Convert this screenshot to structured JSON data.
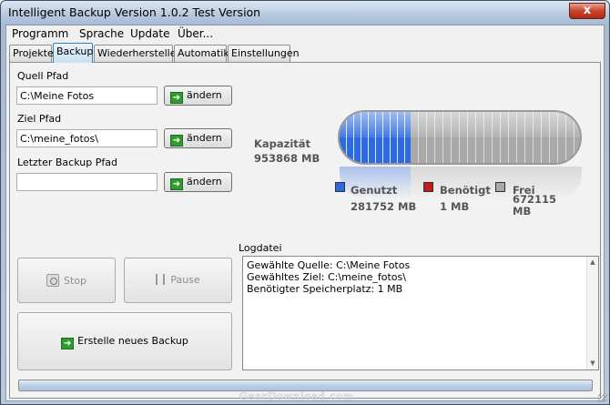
{
  "window": {
    "title": "Intelligent Backup Version 1.0.2 Test Version",
    "close_glyph": "x"
  },
  "menu": [
    "Programm",
    "Sprache",
    "Update",
    "Über..."
  ],
  "tabs": [
    "Projekte",
    "Backup",
    "Wiederherstellen",
    "Automatik",
    "Einstellungen"
  ],
  "active_tab": "Backup",
  "paths": {
    "source_label": "Quell Pfad",
    "source_value": "C:\\Meine Fotos",
    "target_label": "Ziel Pfad",
    "target_value": "C:\\meine_fotos\\",
    "last_label": "Letzter Backup Pfad",
    "last_value": "",
    "change_label": "ändern"
  },
  "capacity": {
    "label": "Kapazität",
    "value": "953868 MB",
    "used_fraction": 0.295,
    "used_label": "Genutzt",
    "used_value": "281752 MB",
    "needed_label": "Benötigt",
    "needed_value": "1 MB",
    "free_label": "Frei",
    "free_value": "672115 MB",
    "colors": {
      "used": "#2d6ae0",
      "needed": "#c41a1a",
      "free": "#a9a9a9"
    }
  },
  "actions": {
    "stop": "Stop",
    "pause": "Pause",
    "create": "Erstelle neues Backup"
  },
  "log": {
    "label": "Logdatei",
    "lines": [
      "Gewählte Quelle: C:\\Meine Fotos",
      "Gewähltes Ziel: C:\\meine_fotos\\",
      "Benötigter Speicherplatz: 1 MB"
    ]
  },
  "watermark": "GearDownload.com"
}
